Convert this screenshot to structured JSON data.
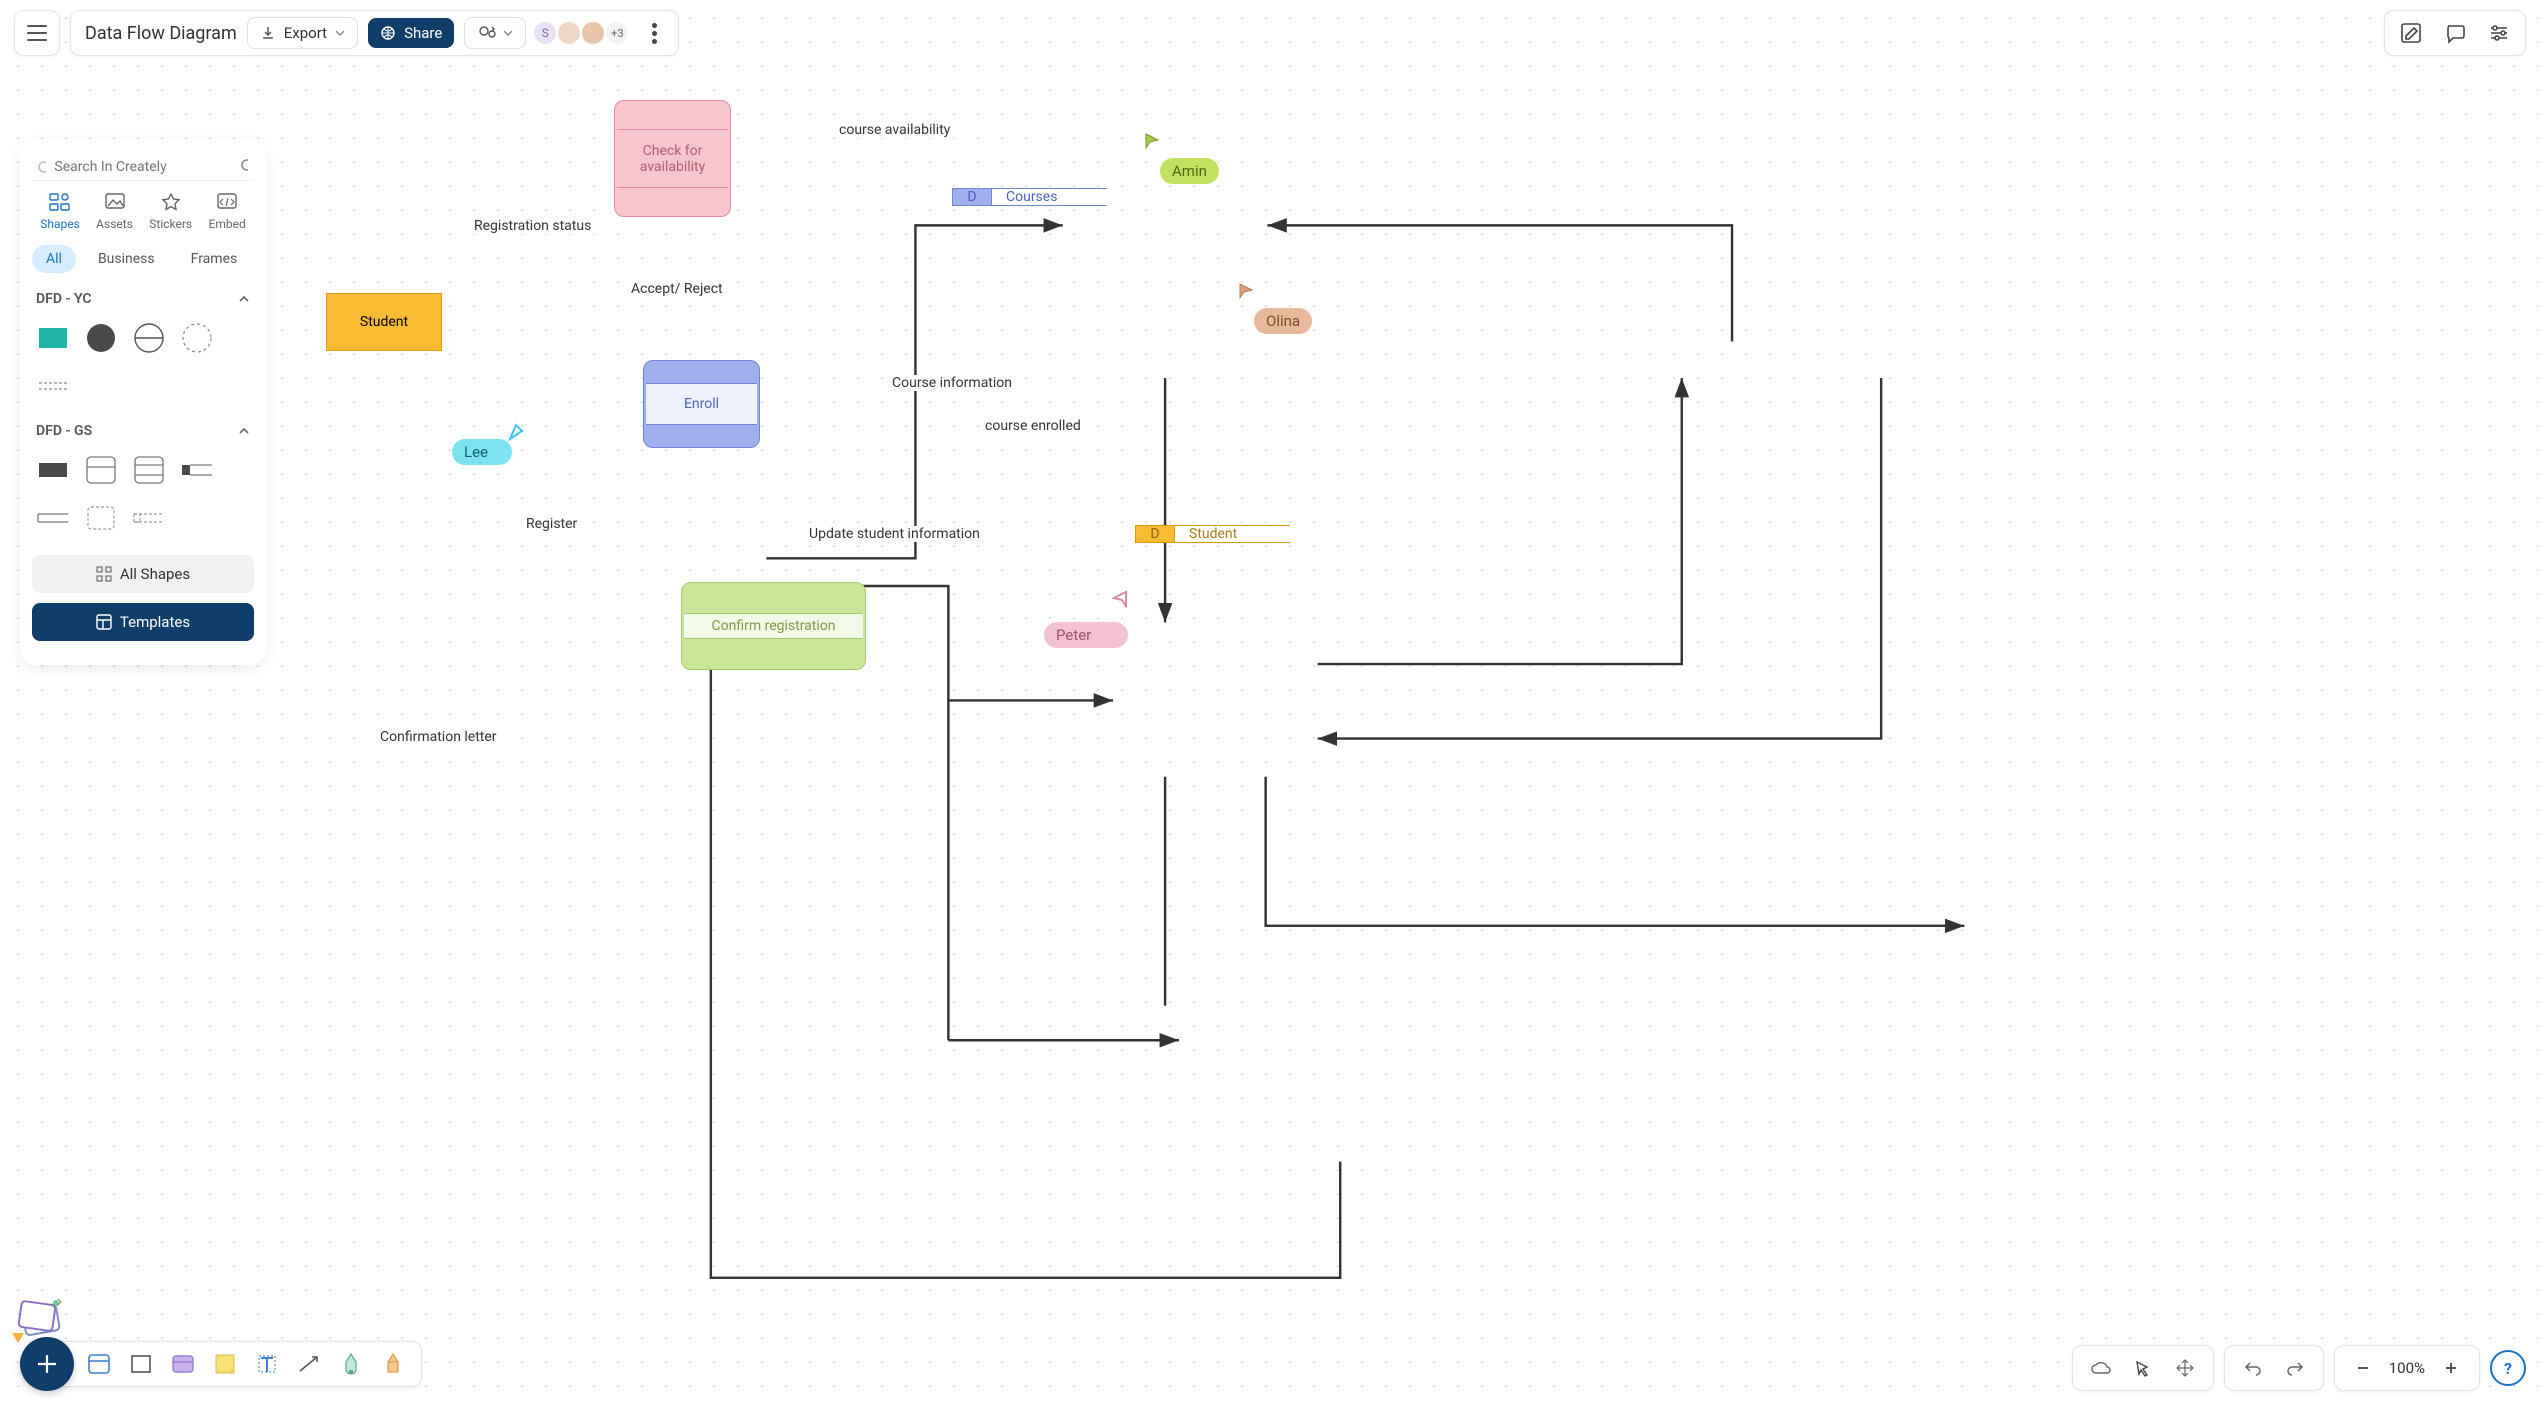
{
  "document": {
    "title": "Data Flow Diagram"
  },
  "toolbar": {
    "export_label": "Export",
    "share_label": "Share",
    "extra_avatars": "+3",
    "avatar_letter": "S"
  },
  "search": {
    "placeholder": "Search In Creately"
  },
  "panel_tabs": {
    "shapes": "Shapes",
    "assets": "Assets",
    "stickers": "Stickers",
    "embed": "Embed"
  },
  "filters": {
    "all": "All",
    "business": "Business",
    "frames": "Frames"
  },
  "sections": {
    "yc": "DFD - YC",
    "gs": "DFD - GS"
  },
  "panel_buttons": {
    "all_shapes": "All Shapes",
    "templates": "Templates"
  },
  "nodes": {
    "student_entity": "Student",
    "check_availability": "Check for availability",
    "enroll": "Enroll",
    "confirm_registration": "Confirm registration",
    "courses_store_label": "D",
    "courses_store": "Courses",
    "student_store_label": "D",
    "student_store": "Student"
  },
  "flows": {
    "registration_status": "Registration status",
    "accept_reject": "Accept/ Reject",
    "register": "Register",
    "confirmation_letter": "Confirmation letter",
    "course_availability": "course availability",
    "course_information": "Course information",
    "course_enrolled": "course enrolled",
    "update_student_info": "Update student information"
  },
  "collaborators": {
    "lee": "Lee",
    "amin": "Amin",
    "olina": "Olina",
    "peter": "Peter"
  },
  "zoom": {
    "level": "100%"
  }
}
